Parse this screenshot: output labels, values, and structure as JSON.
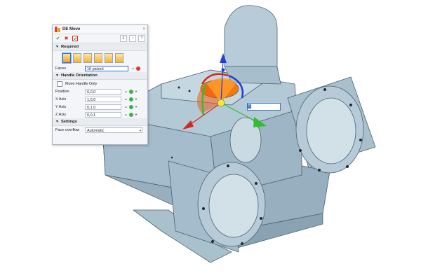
{
  "dialog": {
    "title": "DE Move",
    "close_glyph": "×",
    "toolbar": {
      "ok_icon": "check-icon",
      "cancel_icon": "cancel-icon",
      "apply_icon": "apply-icon",
      "filter_label": "F",
      "info_label": "i",
      "help_label": "?"
    },
    "sections": {
      "required": "Required",
      "handle_orientation": "Handle Orientation",
      "settings": "Settings"
    },
    "faces": {
      "label": "Faces",
      "value": "10 picked"
    },
    "move_handle_only": {
      "label": "Move Handle Only",
      "checked": false
    },
    "position": {
      "label": "Position",
      "value": "0,0,0"
    },
    "x_axis": {
      "label": "X Axis",
      "value": "1,0,0"
    },
    "y_axis": {
      "label": "Y Axis",
      "value": "0,1,0"
    },
    "z_axis": {
      "label": "Z Axis",
      "value": "0,0,1"
    },
    "face_overflow": {
      "label": "Face overflow",
      "value": "Automatic"
    }
  },
  "viewport": {
    "value_readout": "0",
    "colors": {
      "part": "#b3c9d6",
      "part_shade": "#8fa9b8",
      "x_axis": "#d6271f",
      "y_axis": "#2fbf2f",
      "z_axis": "#1f3fd6",
      "highlight_face": "#ee7a16"
    }
  }
}
